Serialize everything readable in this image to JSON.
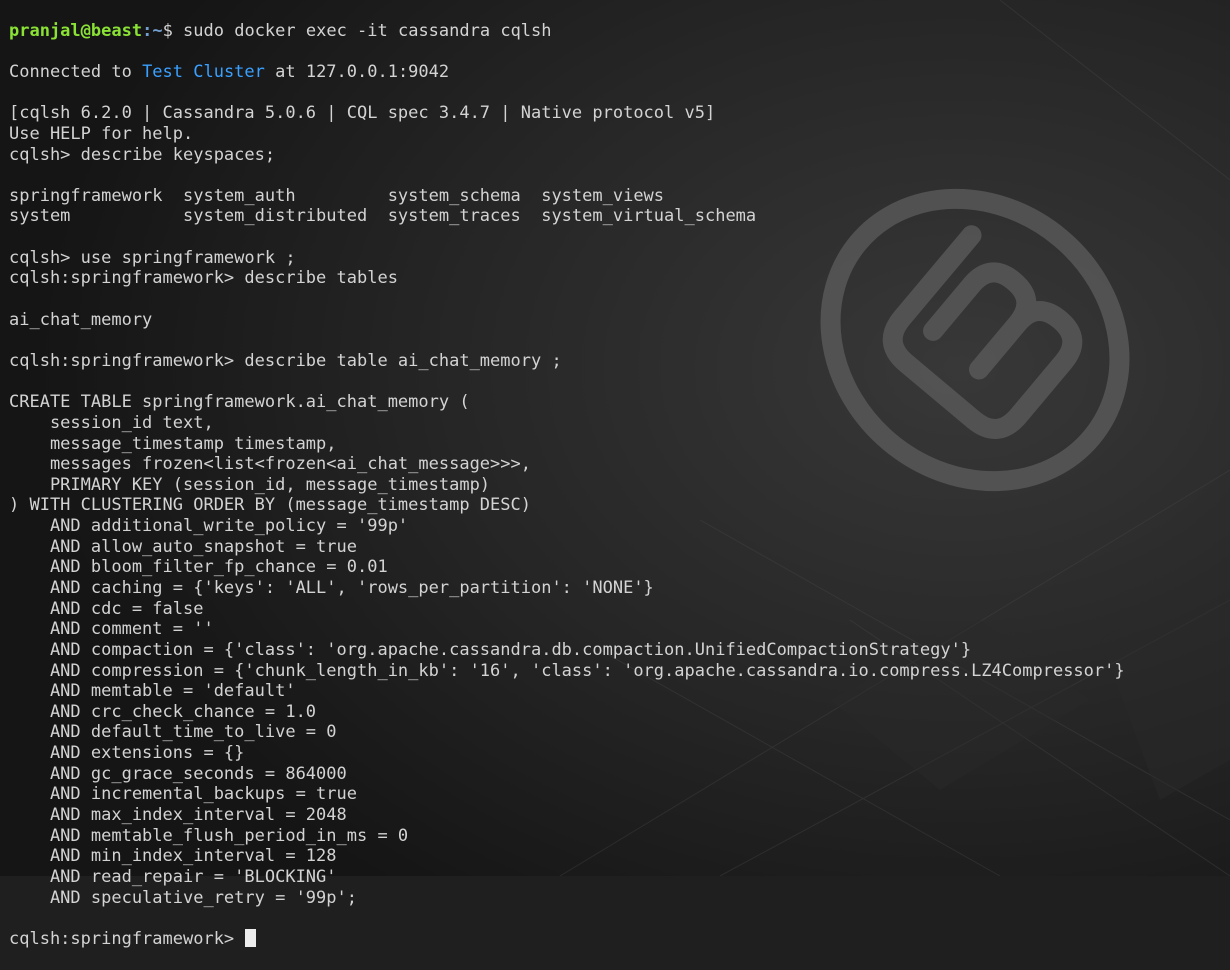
{
  "prompt": {
    "user_host": "pranjal@beast",
    "path": "~",
    "symbol": "$ ",
    "command": "sudo docker exec -it cassandra cqlsh"
  },
  "connected": {
    "prefix": "Connected to ",
    "cluster_name": "Test Cluster",
    "suffix": " at 127.0.0.1:9042"
  },
  "lines_intro": [
    "[cqlsh 6.2.0 | Cassandra 5.0.6 | CQL spec 3.4.7 | Native protocol v5]",
    "Use HELP for help.",
    "cqlsh> describe keyspaces;",
    "",
    "springframework  system_auth         system_schema  system_views",
    "system           system_distributed  system_traces  system_virtual_schema",
    "",
    "cqlsh> use springframework ;",
    "cqlsh:springframework> describe tables",
    "",
    "ai_chat_memory",
    "",
    "cqlsh:springframework> describe table ai_chat_memory ;",
    "",
    "CREATE TABLE springframework.ai_chat_memory (",
    "    session_id text,",
    "    message_timestamp timestamp,",
    "    messages frozen<list<frozen<ai_chat_message>>>,",
    "    PRIMARY KEY (session_id, message_timestamp)",
    ") WITH CLUSTERING ORDER BY (message_timestamp DESC)",
    "    AND additional_write_policy = '99p'",
    "    AND allow_auto_snapshot = true",
    "    AND bloom_filter_fp_chance = 0.01",
    "    AND caching = {'keys': 'ALL', 'rows_per_partition': 'NONE'}",
    "    AND cdc = false",
    "    AND comment = ''",
    "    AND compaction = {'class': 'org.apache.cassandra.db.compaction.UnifiedCompactionStrategy'}",
    "    AND compression = {'chunk_length_in_kb': '16', 'class': 'org.apache.cassandra.io.compress.LZ4Compressor'}",
    "    AND memtable = 'default'",
    "    AND crc_check_chance = 1.0",
    "    AND default_time_to_live = 0",
    "    AND extensions = {}",
    "    AND gc_grace_seconds = 864000",
    "    AND incremental_backups = true",
    "    AND max_index_interval = 2048",
    "    AND memtable_flush_period_in_ms = 0",
    "    AND min_index_interval = 128",
    "    AND read_repair = 'BLOCKING'",
    "    AND speculative_retry = '99p';"
  ],
  "final_prompt": "cqlsh:springframework> ",
  "colors": {
    "background": "#1f1f1f",
    "text": "#d3d3d3",
    "prompt_user": "#8ae234",
    "prompt_path": "#729fcf",
    "cluster_name": "#3aa0ff"
  },
  "icons": {
    "wallpaper_logo": "linux-mint-logo-icon",
    "cursor": "block-cursor"
  }
}
